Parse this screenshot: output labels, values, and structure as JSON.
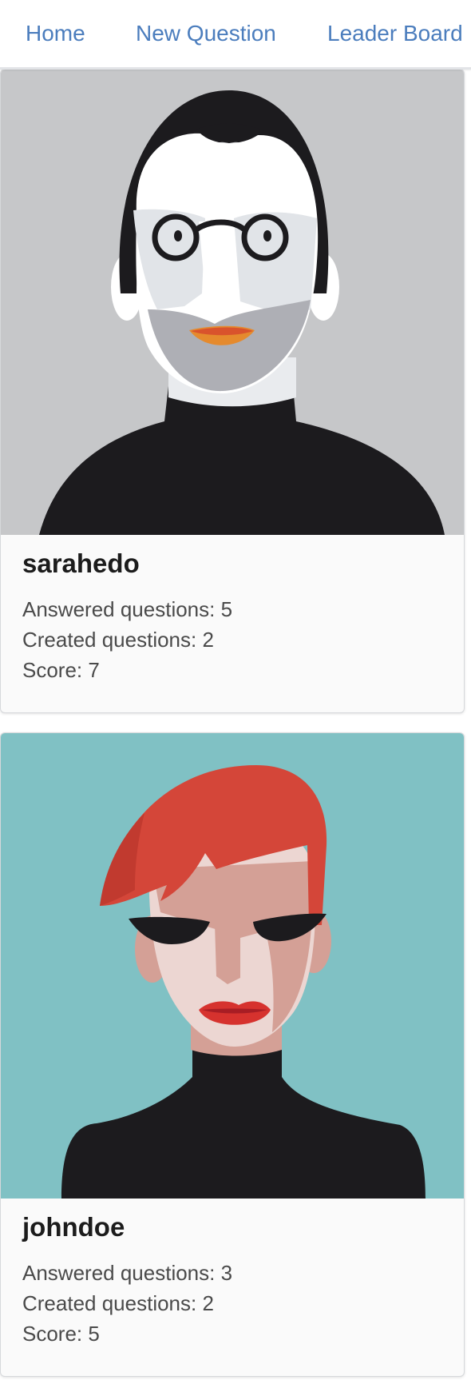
{
  "nav": {
    "home": "Home",
    "new_question": "New Question",
    "leader_board": "Leader Board"
  },
  "users": [
    {
      "username": "sarahedo",
      "answered": "Answered questions: 5",
      "created": "Created questions: 2",
      "score": "Score: 7",
      "avatar": "man-with-glasses-avatar"
    },
    {
      "username": "johndoe",
      "answered": "Answered questions: 3",
      "created": "Created questions: 2",
      "score": "Score: 5",
      "avatar": "woman-with-red-hair-avatar"
    }
  ],
  "colors": {
    "link": "#4b7dbd",
    "avatar_bg_1": "#c6c7c9",
    "avatar_bg_2": "#80c1c4",
    "hair_red": "#d44639"
  }
}
